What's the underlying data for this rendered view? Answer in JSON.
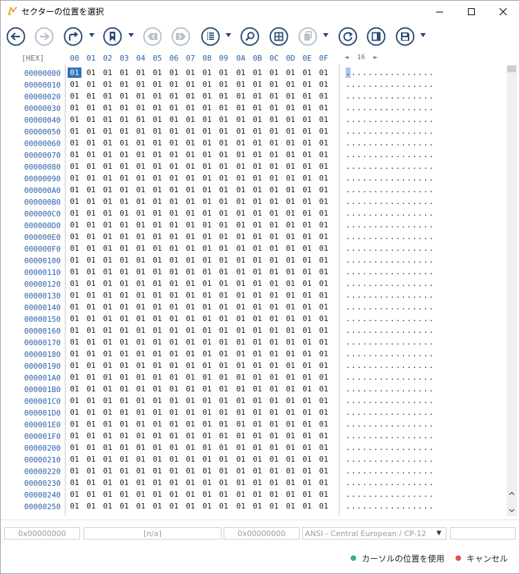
{
  "window": {
    "title": "セクターの位置を選択",
    "controls": [
      "minimize-icon",
      "maximize-icon",
      "close-icon"
    ]
  },
  "toolbar": {
    "buttons": [
      "back-icon",
      "forward-icon",
      "redo-icon",
      "bookmark-icon",
      "tag-prev-icon",
      "tag-next-icon",
      "list-icon",
      "search-icon",
      "grid-icon",
      "copy-icon",
      "refresh-icon",
      "panel-icon",
      "save-icon"
    ]
  },
  "hex": {
    "mode_label": "[HEX]",
    "columns": [
      "00",
      "01",
      "02",
      "03",
      "04",
      "05",
      "06",
      "07",
      "08",
      "09",
      "0A",
      "0B",
      "0C",
      "0D",
      "0E",
      "0F"
    ],
    "bytes_per_row": "16",
    "pager_left": "◄",
    "pager_right": "►",
    "addresses": [
      "00000000",
      "00000010",
      "00000020",
      "00000030",
      "00000040",
      "00000050",
      "00000060",
      "00000070",
      "00000080",
      "00000090",
      "000000A0",
      "000000B0",
      "000000C0",
      "000000D0",
      "000000E0",
      "000000F0",
      "00000100",
      "00000110",
      "00000120",
      "00000130",
      "00000140",
      "00000150",
      "00000160",
      "00000170",
      "00000180",
      "00000190",
      "000001A0",
      "000001B0",
      "000001C0",
      "000001D0",
      "000001E0",
      "000001F0",
      "00000200",
      "00000210",
      "00000220",
      "00000230",
      "00000240",
      "00000250"
    ],
    "byte_value": "01",
    "ascii_row": "................",
    "selected_cell": "01"
  },
  "status": {
    "offset": "0x00000000",
    "value": "[n/a]",
    "position": "0x00000000",
    "encoding": "ANSI - Central European / CP-12",
    "extra": ""
  },
  "footer": {
    "use_cursor_label": "カーソルの位置を使用",
    "cancel_label": "キャンセル",
    "use_cursor_color": "#3cb371",
    "cancel_color": "#e05050"
  },
  "colors": {
    "accent": "#2a4a75",
    "address_blue": "#2b5fa8",
    "selection": "#2f73b8"
  }
}
